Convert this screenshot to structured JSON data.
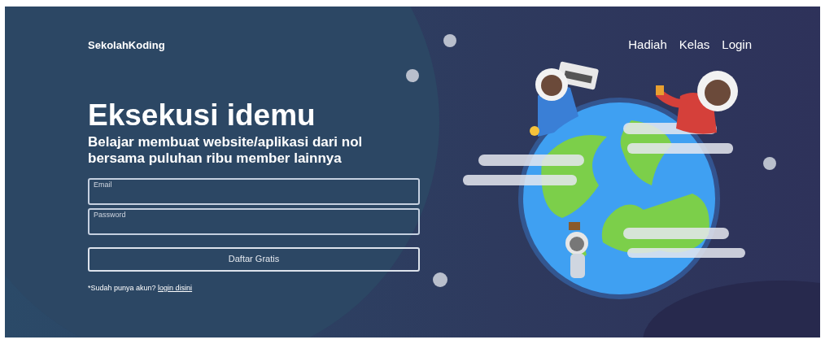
{
  "brand": "SekolahKoding",
  "nav": [
    {
      "label": "Hadiah"
    },
    {
      "label": "Kelas"
    },
    {
      "label": "Login"
    }
  ],
  "headline": "Eksekusi idemu",
  "subheadline": "Belajar membuat website/aplikasi dari nol bersama puluhan ribu member lainnya",
  "fields": [
    {
      "placeholder": "Email"
    },
    {
      "placeholder": "Password"
    }
  ],
  "submit": "Daftar Gratis",
  "footnote": {
    "text": "*Sudah punya akun?",
    "link": "login disini"
  }
}
